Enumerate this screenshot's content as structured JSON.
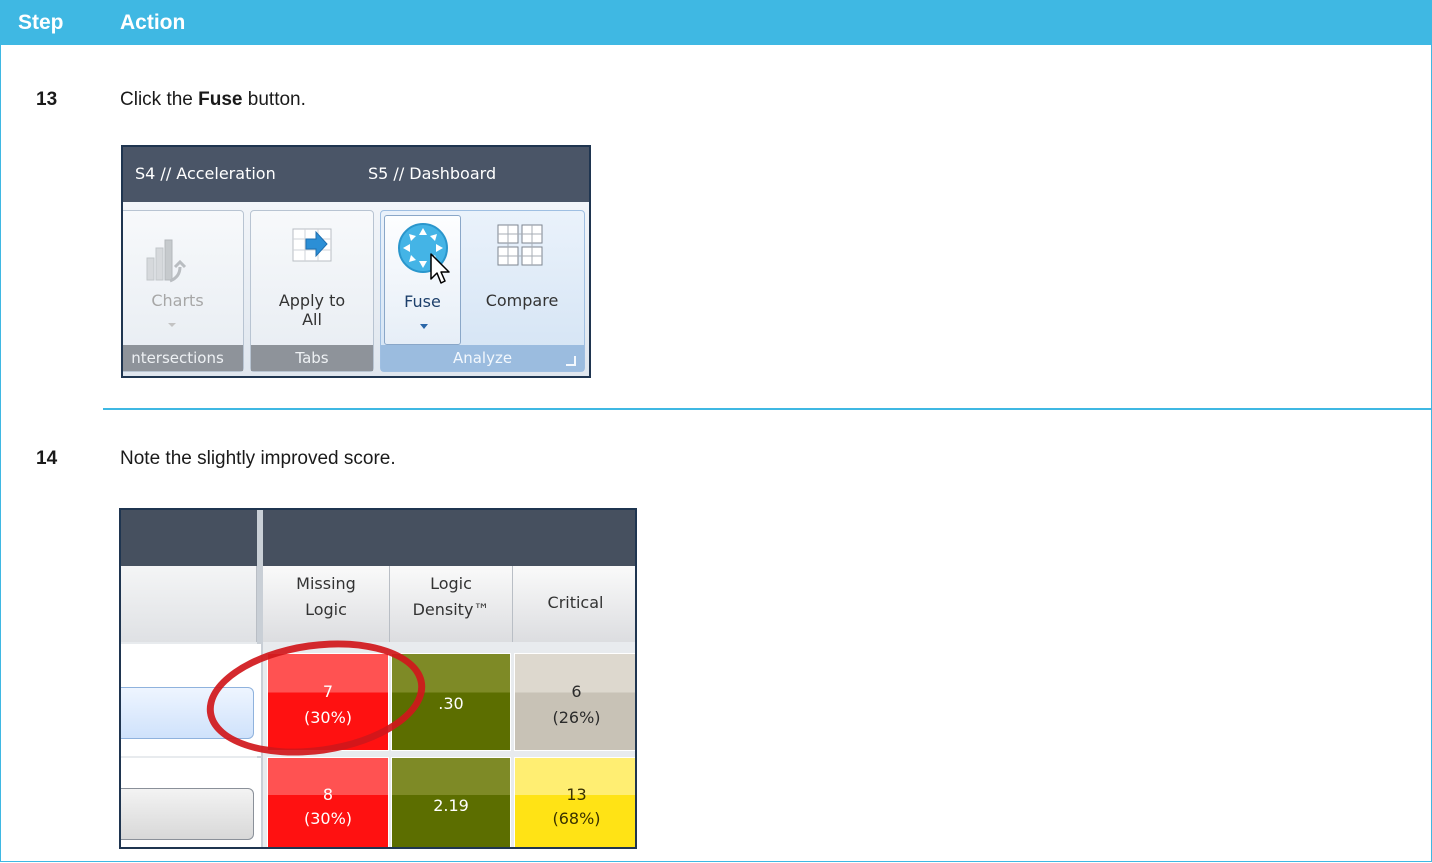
{
  "table": {
    "header": {
      "step": "Step",
      "action": "Action"
    },
    "rows": [
      {
        "number": "13",
        "text_before": "Click the ",
        "text_bold": "Fuse",
        "text_after": " button."
      },
      {
        "number": "14",
        "text": "Note the slightly improved score."
      }
    ]
  },
  "ribbon": {
    "tabs": [
      "S4 // Acceleration",
      "S5 // Dashboard"
    ],
    "groups": [
      {
        "label": "ntersections",
        "buttons": [
          {
            "label": "Charts",
            "state": "disabled"
          }
        ]
      },
      {
        "label": "Tabs",
        "buttons": [
          {
            "label_line1": "Apply to",
            "label_line2": "All"
          }
        ]
      },
      {
        "label": "Analyze",
        "buttons": [
          {
            "label": "Fuse",
            "state": "hovered"
          },
          {
            "label": "Compare"
          }
        ]
      }
    ]
  },
  "score": {
    "columns": [
      {
        "line1": "Missing",
        "line2": "Logic"
      },
      {
        "line1": "Logic",
        "line2": "Density™"
      },
      {
        "line1": "Critical"
      }
    ],
    "rows": [
      {
        "missing_logic": {
          "count": "7",
          "pct": "(30%)"
        },
        "logic_density": ".30",
        "critical": {
          "count": "6",
          "pct": "(26%)"
        }
      },
      {
        "missing_logic": {
          "count": "8",
          "pct": "(30%)"
        },
        "logic_density": "2.19",
        "critical": {
          "count": "13",
          "pct": "(68%)"
        }
      }
    ]
  },
  "colors": {
    "header_blue": "#3fb8e3",
    "score_red": "#ff1111",
    "score_olive": "#5c6e00",
    "score_gray": "#c8c2b6",
    "score_yellow": "#ffe315",
    "highlight_circle": "#d0171b"
  },
  "icons": [
    "bar-chart-icon",
    "apply-to-all-icon",
    "fuse-icon",
    "compare-grid-icon",
    "mouse-cursor-icon",
    "dialog-launcher-icon"
  ]
}
